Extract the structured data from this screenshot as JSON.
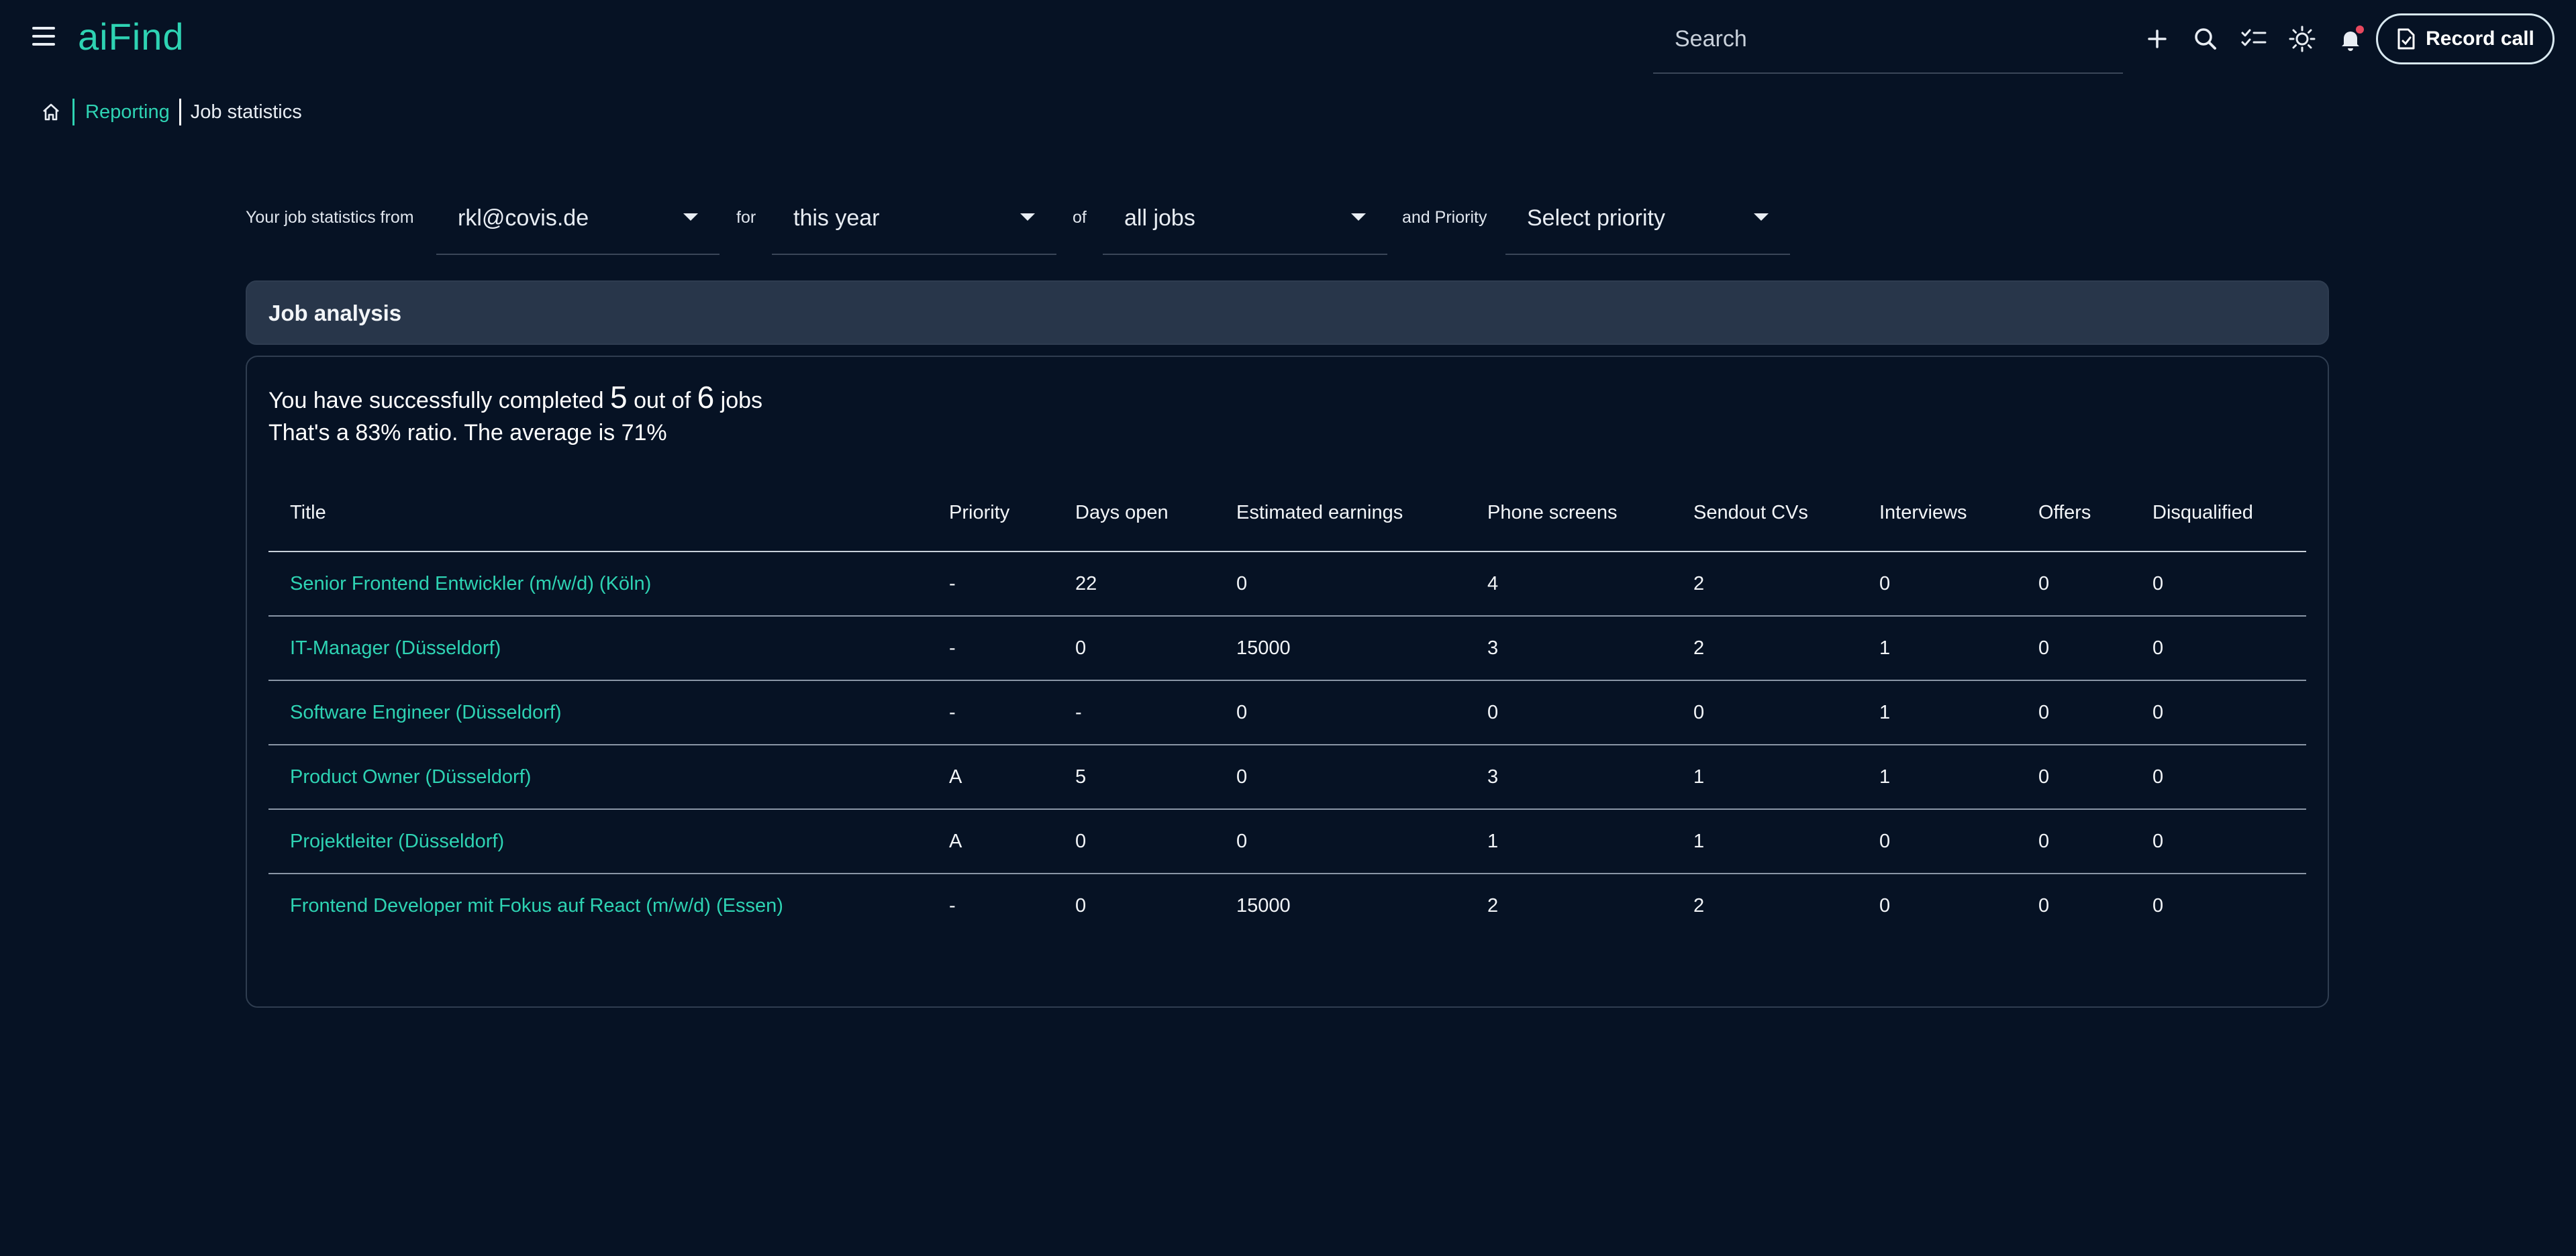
{
  "app": {
    "logo": "aiFind"
  },
  "header": {
    "search_placeholder": "Search",
    "icons": [
      "add-icon",
      "search-icon",
      "checklist-icon",
      "theme-sun-icon",
      "notification-bell-icon"
    ],
    "record_call_label": "Record call"
  },
  "breadcrumb": {
    "home_icon": "home-icon",
    "section": "Reporting",
    "current": "Job statistics"
  },
  "filters": {
    "prefix": "Your job statistics from",
    "user_value": "rkl@covis.de",
    "for_label": "for",
    "period_value": "this year",
    "of_label": "of",
    "jobs_value": "all jobs",
    "priority_label": "and Priority",
    "priority_placeholder": "Select priority"
  },
  "panel": {
    "title": "Job analysis",
    "summary_prefix": "You have successfully completed",
    "completed": "5",
    "summary_mid": "out of",
    "total": "6",
    "summary_suffix": "jobs",
    "ratio_line": "That's a 83% ratio. The average is 71%"
  },
  "table": {
    "columns": [
      "Title",
      "Priority",
      "Days open",
      "Estimated earnings",
      "Phone screens",
      "Sendout CVs",
      "Interviews",
      "Offers",
      "Disqualified"
    ],
    "rows": [
      [
        "Senior Frontend Entwickler (m/w/d) (Köln)",
        "-",
        "22",
        "0",
        "4",
        "2",
        "0",
        "0",
        "0"
      ],
      [
        "IT-Manager (Düsseldorf)",
        "-",
        "0",
        "15000",
        "3",
        "2",
        "1",
        "0",
        "0"
      ],
      [
        "Software Engineer (Düsseldorf)",
        "-",
        "-",
        "0",
        "0",
        "0",
        "1",
        "0",
        "0"
      ],
      [
        "Product Owner (Düsseldorf)",
        "A",
        "5",
        "0",
        "3",
        "1",
        "1",
        "0",
        "0"
      ],
      [
        "Projektleiter (Düsseldorf)",
        "A",
        "0",
        "0",
        "1",
        "1",
        "0",
        "0",
        "0"
      ],
      [
        "Frontend Developer mit Fokus auf React (m/w/d) (Essen)",
        "-",
        "0",
        "15000",
        "2",
        "2",
        "0",
        "0",
        "0"
      ]
    ]
  },
  "colors": {
    "background": "#061224",
    "accent": "#2ed3b3",
    "panel_header": "#28364a",
    "notification_dot": "#e8485e"
  }
}
